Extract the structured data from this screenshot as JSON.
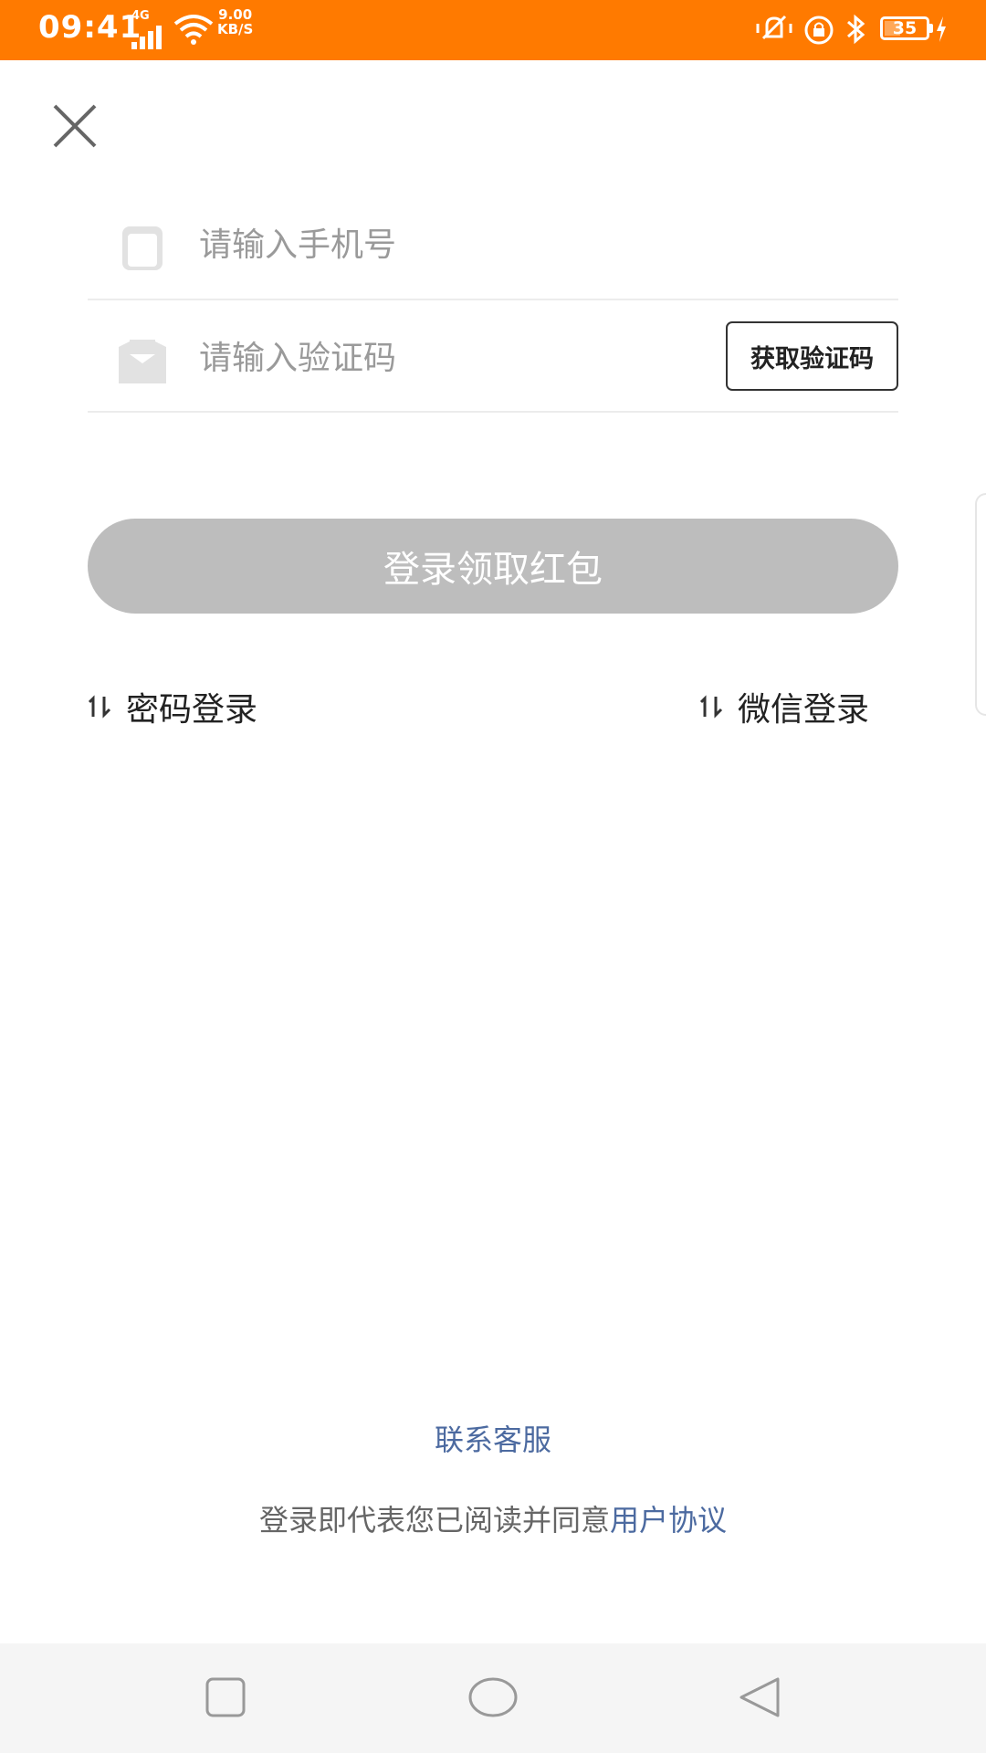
{
  "status_bar": {
    "time": "09:41",
    "network_type": "4G",
    "net_speed_value": "9.00",
    "net_speed_unit": "KB/S",
    "battery_level": "35",
    "color": "#ff7a00"
  },
  "form": {
    "phone_placeholder": "请输入手机号",
    "code_placeholder": "请输入验证码",
    "get_code_label": "获取验证码",
    "login_button_label": "登录领取红包"
  },
  "alt_login": {
    "password_label": "密码登录",
    "wechat_label": "微信登录",
    "switch_icon": "⇅"
  },
  "footer": {
    "contact_label": "联系客服",
    "agreement_prefix": "登录即代表您已阅读并同意",
    "agreement_link": "用户协议",
    "link_color": "#4c6aa0"
  },
  "icons": [
    "close-icon",
    "phone-icon",
    "message-icon",
    "switch-icon",
    "nav-recent-icon",
    "nav-home-icon",
    "nav-back-icon"
  ]
}
